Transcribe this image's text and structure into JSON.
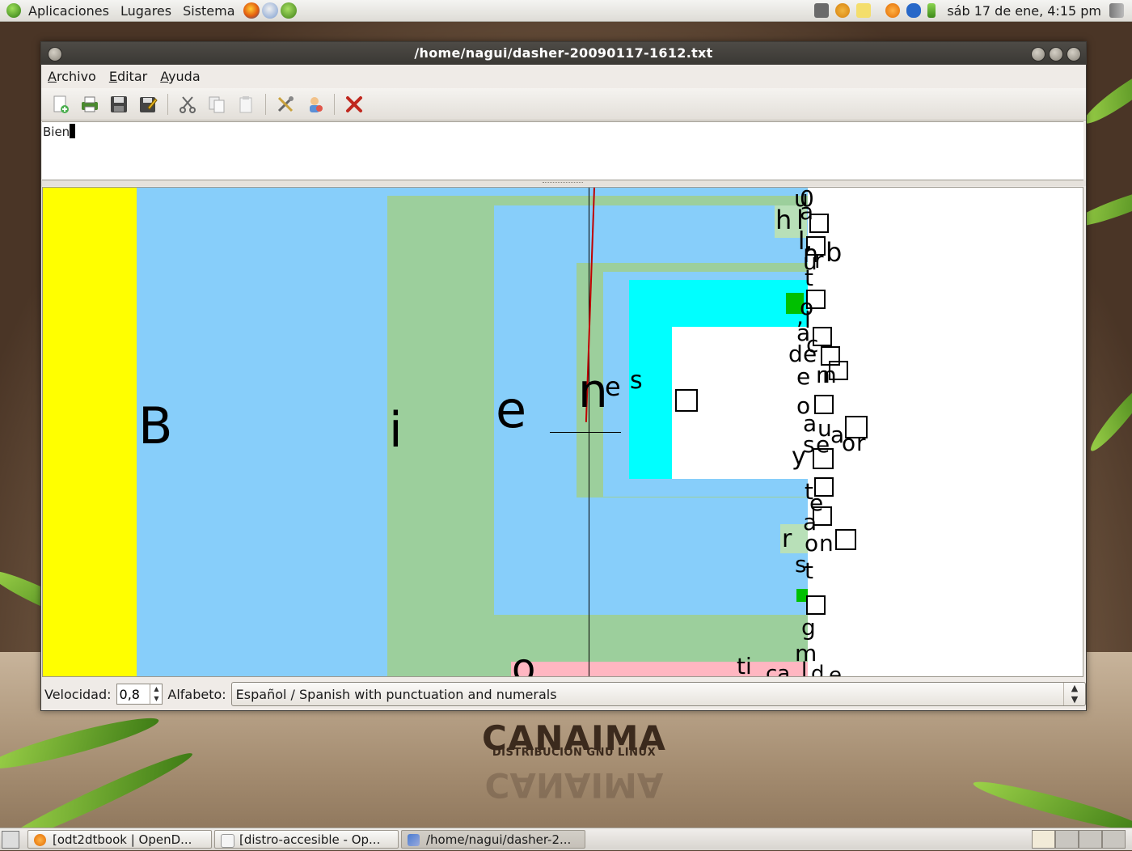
{
  "top_panel": {
    "menus": [
      "Aplicaciones",
      "Lugares",
      "Sistema"
    ],
    "clock": "sáb 17 de ene,  4:15 pm"
  },
  "window": {
    "title": "/home/nagui/dasher-20090117-1612.txt",
    "menubar": {
      "archivo": {
        "first": "A",
        "rest": "rchivo"
      },
      "editar": {
        "first": "E",
        "rest": "ditar"
      },
      "ayuda": {
        "first": "A",
        "rest": "yuda"
      }
    },
    "toolbar_icons": [
      "new-icon",
      "print-icon",
      "save-icon",
      "save-as-icon",
      "cut-icon",
      "copy-icon",
      "paste-icon",
      "preferences-icon",
      "help-icon",
      "quit-icon"
    ],
    "text_content": "Bien",
    "dasher": {
      "big_letters": [
        "B",
        "i",
        "e",
        "n",
        "e",
        "s",
        "o"
      ],
      "right_column": [
        "u",
        "0",
        "a",
        "h",
        "l",
        "[",
        "l,",
        "n",
        "b",
        "u",
        "r",
        "t",
        "d",
        "[",
        "o",
        ",",
        "l",
        "a",
        "c",
        "d",
        "e",
        "n",
        "e",
        "n",
        "[",
        "o",
        "[",
        "a",
        "u",
        "a",
        "s",
        "e",
        "o",
        "r",
        "y",
        "t",
        "[",
        "e",
        "a",
        "r",
        "l",
        "o",
        "n",
        "s",
        "t",
        "[",
        "l",
        "g",
        "m",
        "é",
        "ti",
        "ca",
        "l",
        "d",
        "e"
      ]
    },
    "statusbar": {
      "speed_label": "Velocidad:",
      "speed_value": "0,8",
      "alphabet_label": "Alfabeto:",
      "alphabet_value": "Español / Spanish with punctuation and numerals"
    }
  },
  "wallpaper": {
    "brand": "CANAIMA",
    "tagline": "DISTRIBUCIÓN GNU LINUX"
  },
  "taskbar": {
    "items": [
      {
        "label": "[odt2dtbook | OpenD..."
      },
      {
        "label": "[distro-accesible - Op..."
      },
      {
        "label": "/home/nagui/dasher-2..."
      }
    ]
  },
  "colors": {
    "yellow": "#ffff00",
    "lightblue": "#87cefa",
    "green": "#9ccf9c",
    "cyan": "#00ffff",
    "pink": "#ffb6c1"
  }
}
